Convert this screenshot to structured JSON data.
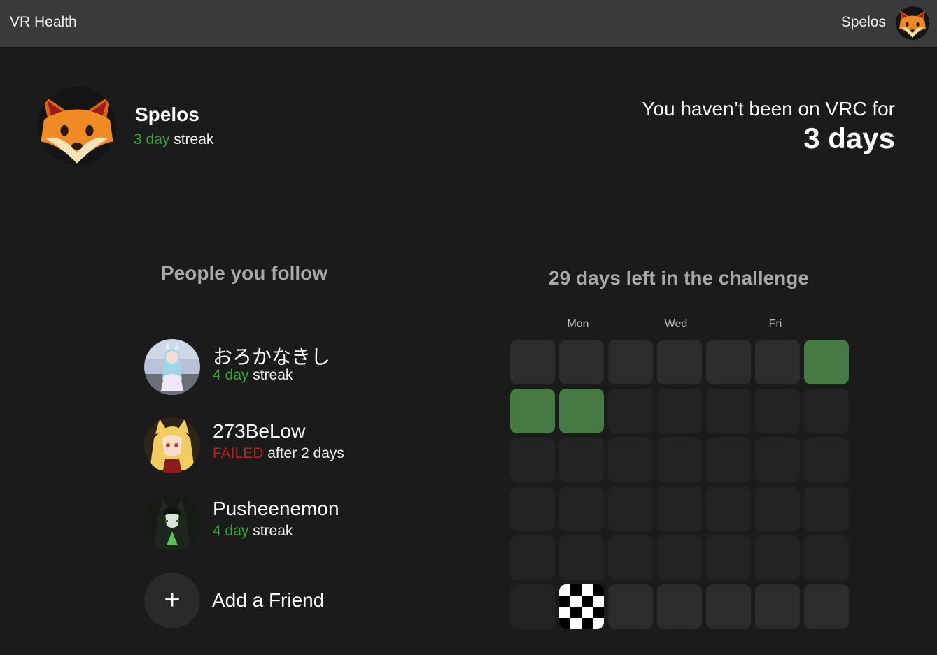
{
  "header": {
    "app_title": "VR Health",
    "username": "Spelos",
    "avatar_icon": "fox-face-icon"
  },
  "profile": {
    "name": "Spelos",
    "streak_count": "3 day",
    "streak_suffix": " streak",
    "avatar_icon": "fox-face-icon"
  },
  "absence": {
    "label": "You haven’t been on VRC for",
    "value": "3 days"
  },
  "following": {
    "heading": "People you follow",
    "friends": [
      {
        "name": "おろかなきし",
        "status_highlight": "4 day",
        "status_rest": " streak",
        "status": "streak"
      },
      {
        "name": "273BeLow",
        "status_highlight": "FAILED",
        "status_rest": " after 2 days",
        "status": "failed"
      },
      {
        "name": "Pusheenemon",
        "status_highlight": "4 day",
        "status_rest": " streak",
        "status": "streak"
      }
    ],
    "add_label": "Add a Friend",
    "add_icon": "+"
  },
  "challenge": {
    "heading": "29 days left in the challenge",
    "day_labels": [
      "Mon",
      "Wed",
      "Fri"
    ],
    "grid_rows": [
      [
        "past",
        "past",
        "past",
        "past",
        "past",
        "past",
        "done"
      ],
      [
        "done",
        "done",
        "future",
        "future",
        "future",
        "future",
        "future"
      ],
      [
        "future",
        "future",
        "future",
        "future",
        "future",
        "future",
        "future"
      ],
      [
        "future",
        "future",
        "future",
        "future",
        "future",
        "future",
        "future"
      ],
      [
        "future",
        "future",
        "future",
        "future",
        "future",
        "future",
        "future"
      ],
      [
        "future",
        "finish",
        "past",
        "past",
        "past",
        "past",
        "past"
      ]
    ]
  },
  "colors": {
    "streak_green": "#2faa2f",
    "failed_red": "#c31a1a",
    "completed_cell": "#457a45",
    "topbar": "#3a3a3a",
    "background": "#1b1b1b"
  }
}
